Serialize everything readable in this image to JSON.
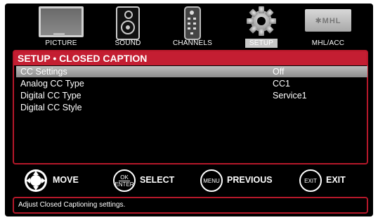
{
  "tabs": [
    {
      "label": "PICTURE",
      "icon": "tv-icon"
    },
    {
      "label": "SOUND",
      "icon": "speaker-icon"
    },
    {
      "label": "CHANNELS",
      "icon": "remote-icon"
    },
    {
      "label": "SETUP",
      "icon": "gear-icon",
      "active": true
    },
    {
      "label": "MHL/ACC",
      "icon": "mhl-icon",
      "logo_text": "✱MHL"
    }
  ],
  "panel": {
    "title": "SETUP • CLOSED CAPTION",
    "rows": [
      {
        "name": "CC Settings",
        "value": "Off",
        "selected": true
      },
      {
        "name": "Analog CC Type",
        "value": "CC1"
      },
      {
        "name": "Digital CC Type",
        "value": "Service1"
      },
      {
        "name": "Digital CC Style",
        "value": ""
      }
    ]
  },
  "keys": [
    {
      "icon": "dpad-icon",
      "label": "MOVE"
    },
    {
      "icon": "ok-enter-icon",
      "top": "OK",
      "bottom": "ENTER",
      "label": "SELECT"
    },
    {
      "icon": "menu-icon",
      "top": "MENU",
      "label": "PREVIOUS"
    },
    {
      "icon": "exit-icon",
      "top": "EXIT",
      "label": "EXIT"
    }
  ],
  "help_text": "Adjust Closed Captioning settings.",
  "colors": {
    "accent": "#c41e32",
    "selected_row": "#a8a8a8",
    "background": "#000000"
  }
}
